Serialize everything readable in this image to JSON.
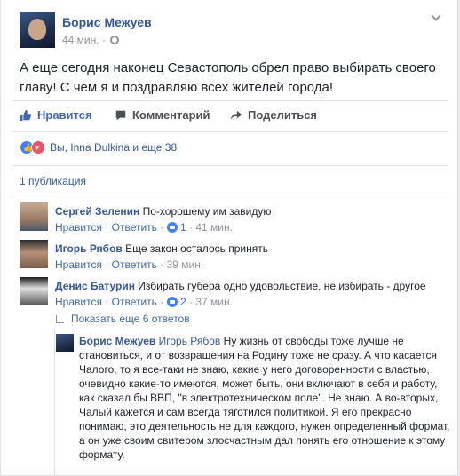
{
  "post": {
    "author": "Борис Межуев",
    "time": "44 мин.",
    "separator": "·",
    "privacy_icon": "globe-icon",
    "text": "А еще сегодня наконец Севастополь обрел право выбирать своего главу! С чем я и поздравляю всех жителей города!"
  },
  "actions": {
    "like": "Нравится",
    "comment": "Комментарий",
    "share": "Поделиться"
  },
  "reactions": {
    "summary": "Вы, Inna Dulkina и еще 38",
    "icons": [
      "like-icon",
      "love-icon"
    ]
  },
  "shares": "1 публикация",
  "comments": [
    {
      "author": "Сергей Зеленин",
      "text": "По-хорошему им завидую",
      "like": "Нравится",
      "reply": "Ответить",
      "sep": "·",
      "likes": "1",
      "time": "41 мин."
    },
    {
      "author": "Игорь Рябов",
      "text": "Еще закон осталось принять",
      "like": "Нравится",
      "reply": "Ответить",
      "sep": "·",
      "time": "39 мин."
    },
    {
      "author": "Денис Батурин",
      "text": "Избирать губера одно удовольствие, не избирать - другое",
      "like": "Нравится",
      "reply": "Ответить",
      "sep": "·",
      "likes": "2",
      "time": "37 мин."
    }
  ],
  "more_replies": "Показать еще 6 ответов",
  "reply": {
    "author": "Борис Межуев",
    "tag": "Игорь Рябов",
    "text": "Ну жизнь от свободы тоже лучше не становиться, и от возвращения на Родину тоже не сразу. А что касается Чалого, то я все-таки не знаю, какие у него договоренности с властью, очевидно какие-то имеются, может быть, они включают в себя и работу, как сказал бы ВВП, \"в электротехническом поле\". Не знаю. А во-вторых, Чалый кажется и сам всегда тяготился политикой. Я его прекрасно понимаю, это деятельность не для каждого, нужен определенный формат, а он уже своим свитером злосчастным дал понять его отношение к этому формату."
  }
}
